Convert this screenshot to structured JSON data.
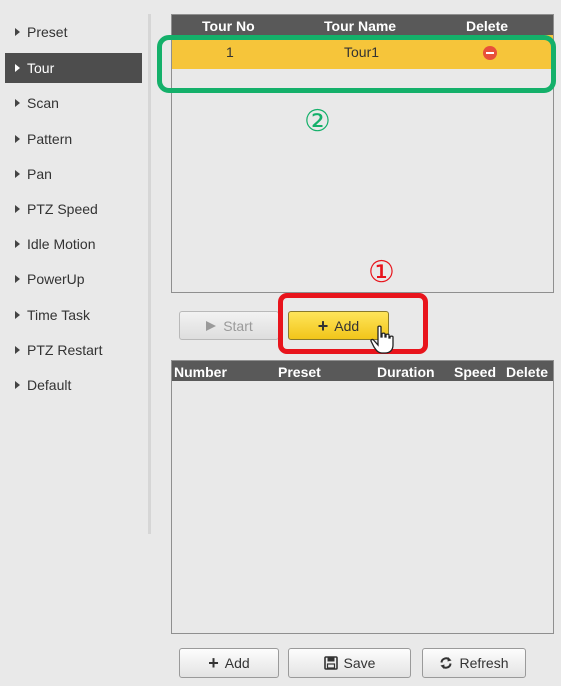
{
  "sidebar": {
    "items": [
      {
        "label": "Preset",
        "active": false
      },
      {
        "label": "Tour",
        "active": true
      },
      {
        "label": "Scan",
        "active": false
      },
      {
        "label": "Pattern",
        "active": false
      },
      {
        "label": "Pan",
        "active": false
      },
      {
        "label": "PTZ Speed",
        "active": false
      },
      {
        "label": "Idle Motion",
        "active": false
      },
      {
        "label": "PowerUp",
        "active": false
      },
      {
        "label": "Time Task",
        "active": false
      },
      {
        "label": "PTZ Restart",
        "active": false
      },
      {
        "label": "Default",
        "active": false
      }
    ]
  },
  "tour_table": {
    "headers": {
      "tour_no": "Tour No",
      "tour_name": "Tour Name",
      "delete": "Delete"
    },
    "rows": [
      {
        "tour_no": "1",
        "tour_name": "Tour1",
        "delete_icon": "remove-icon"
      }
    ]
  },
  "tour_buttons": {
    "start_label": "Start",
    "add_label": "Add"
  },
  "preset_table": {
    "headers": {
      "number": "Number",
      "preset": "Preset",
      "duration": "Duration",
      "speed": "Speed",
      "delete": "Delete"
    },
    "rows": []
  },
  "bottom_buttons": {
    "add_label": "Add",
    "save_label": "Save",
    "refresh_label": "Refresh"
  },
  "annotations": {
    "marker_1": "①",
    "marker_2": "②",
    "colors": {
      "marker_1": "#e8141c",
      "marker_2": "#14b06a"
    }
  },
  "colors": {
    "selected_row": "#f6c53a",
    "header_bg": "#595959",
    "active_sidebar": "#4d4d4d",
    "add_button": "#f1c51a"
  }
}
